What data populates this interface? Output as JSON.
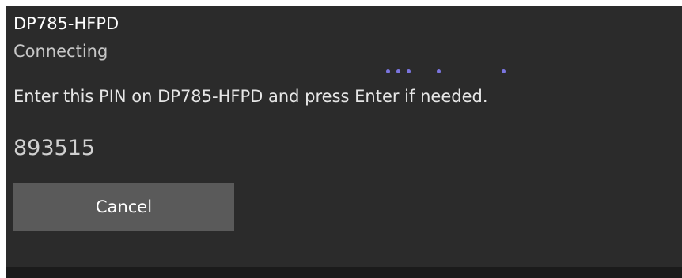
{
  "dialog": {
    "device_name": "DP785-HFPD",
    "status": "Connecting",
    "instruction": "Enter this PIN on DP785-HFPD and press Enter if needed.",
    "pin": "893515",
    "cancel_label": "Cancel"
  },
  "progress_indicator": {
    "dot_count": 5,
    "color": "#7b75e0"
  },
  "colors": {
    "panel_background": "#2b2b2b",
    "button_background": "#5a5a5a",
    "bottom_strip": "#1b1b1b"
  }
}
